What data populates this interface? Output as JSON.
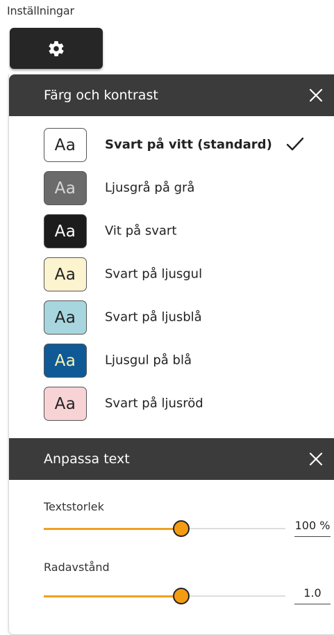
{
  "settings": {
    "label": "Inställningar",
    "button_icon": "gear-icon"
  },
  "color_section": {
    "title": "Färg och kontrast",
    "close_icon": "close-icon",
    "items": [
      {
        "swatch_text": "Aa",
        "label": "Svart på vitt (standard)",
        "selected": true,
        "bg": "#ffffff",
        "fg": "#222222"
      },
      {
        "swatch_text": "Aa",
        "label": "Ljusgrå på grå",
        "selected": false,
        "bg": "#6b6b6b",
        "fg": "#d8d8d8"
      },
      {
        "swatch_text": "Aa",
        "label": "Vit på svart",
        "selected": false,
        "bg": "#1c1c1c",
        "fg": "#ffffff"
      },
      {
        "swatch_text": "Aa",
        "label": "Svart på ljusgul",
        "selected": false,
        "bg": "#fcf3cf",
        "fg": "#222222"
      },
      {
        "swatch_text": "Aa",
        "label": "Svart på ljusblå",
        "selected": false,
        "bg": "#a7d6df",
        "fg": "#222222"
      },
      {
        "swatch_text": "Aa",
        "label": "Ljusgul på blå",
        "selected": false,
        "bg": "#0f5a96",
        "fg": "#fdf3b0"
      },
      {
        "swatch_text": "Aa",
        "label": "Svart på ljusröd",
        "selected": false,
        "bg": "#f7d3d6",
        "fg": "#222222"
      }
    ]
  },
  "text_section": {
    "title": "Anpassa text",
    "close_icon": "close-icon",
    "text_size": {
      "label": "Textstorlek",
      "value": "100 %",
      "fraction": 0.57
    },
    "line_spacing": {
      "label": "Radavstånd",
      "value": "1.0",
      "fraction": 0.57
    }
  },
  "colors": {
    "accent": "#f39c12",
    "header_bg": "#3b3b3b",
    "button_bg": "#262626"
  }
}
